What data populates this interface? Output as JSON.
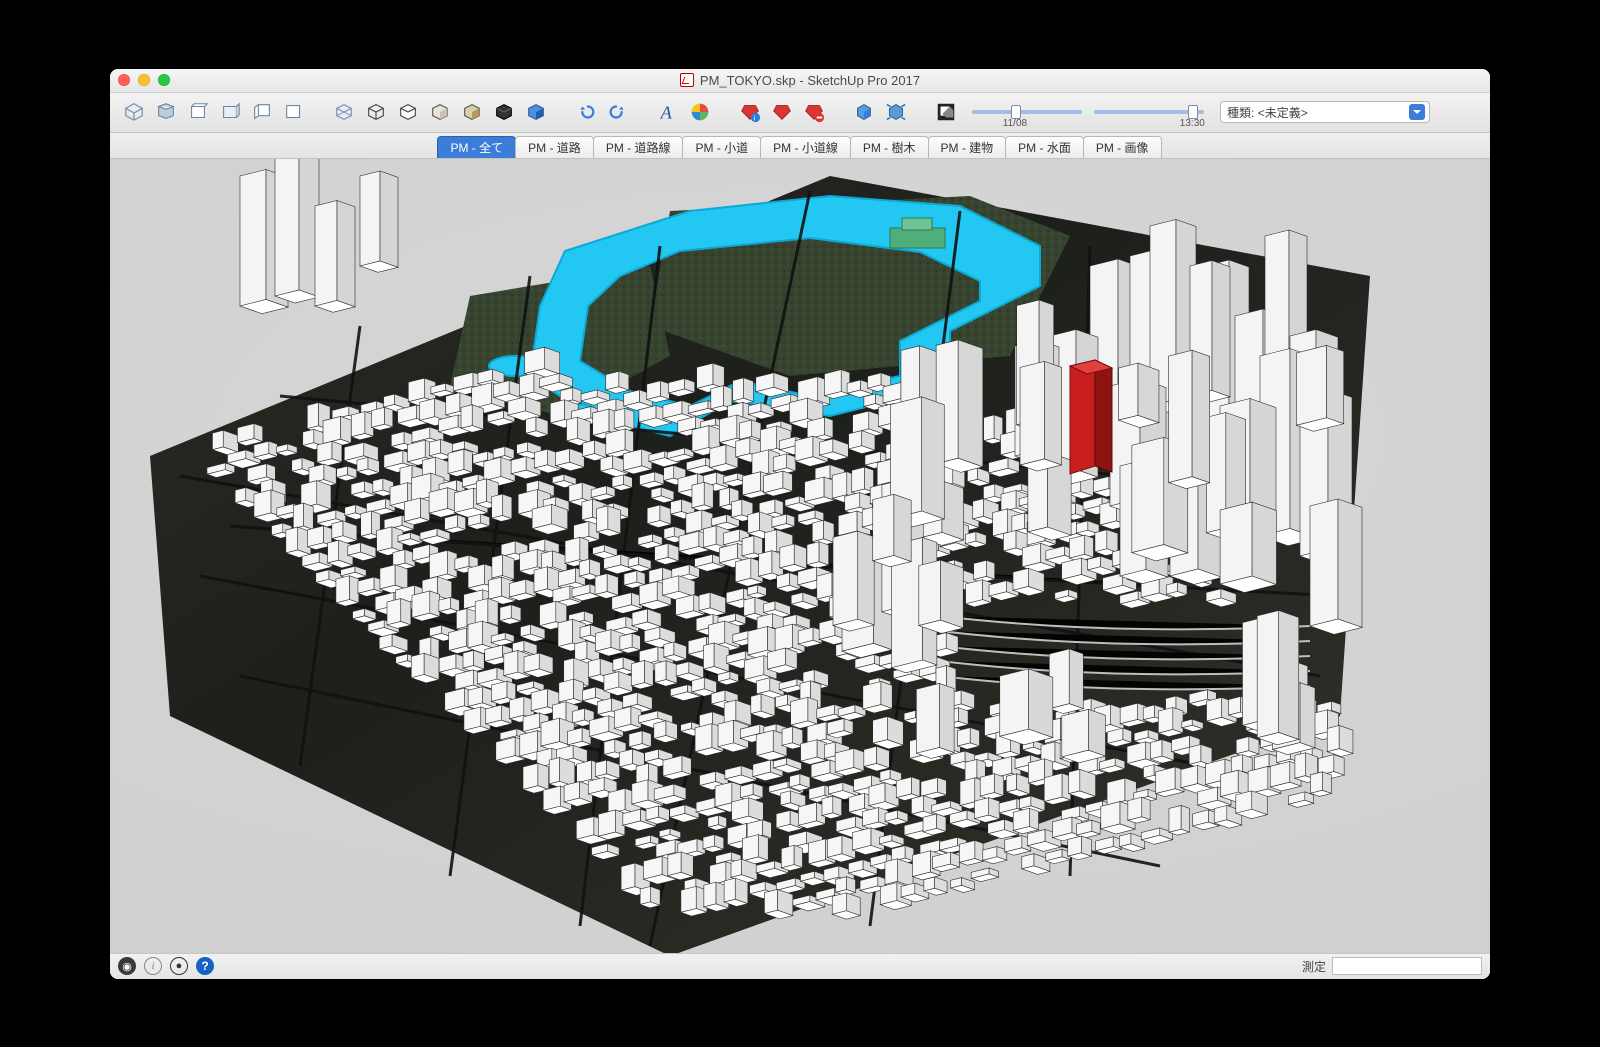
{
  "window": {
    "title": "PM_TOKYO.skp - SketchUp Pro 2017"
  },
  "toolbar": {
    "icons": [
      "iso-view",
      "top-view",
      "front-view",
      "back-view",
      "left-view",
      "right-view",
      "style1",
      "style2",
      "style3",
      "style4",
      "style5",
      "style6",
      "style7",
      "undo",
      "redo",
      "text-A",
      "color-wheel",
      "ruby-info",
      "ruby-add",
      "ruby-ext",
      "cube-wire",
      "cube-explode",
      "shadow-toggle"
    ],
    "date_slider": {
      "value_pos": 35,
      "label": "11/08"
    },
    "time_slider": {
      "value_pos": 85,
      "label": "13:30"
    },
    "type_label": "種類:",
    "type_value": "<未定義>"
  },
  "scene_tabs": [
    {
      "label": "PM - 全て",
      "active": true
    },
    {
      "label": "PM - 道路",
      "active": false
    },
    {
      "label": "PM - 道路線",
      "active": false
    },
    {
      "label": "PM - 小道",
      "active": false
    },
    {
      "label": "PM - 小道線",
      "active": false
    },
    {
      "label": "PM - 樹木",
      "active": false
    },
    {
      "label": "PM - 建物",
      "active": false
    },
    {
      "label": "PM - 水面",
      "active": false
    },
    {
      "label": "PM - 画像",
      "active": false
    }
  ],
  "statusbar": {
    "measure_label": "測定",
    "measure_value": ""
  },
  "colors": {
    "water": "#22c7f2",
    "building": "#f2f2f2",
    "building_edge": "#2b2b2b",
    "ground_dark": "#1e1f1d",
    "ground_green": "#3e4a32",
    "road": "#2a2a2a",
    "accent_red": "#c81e1e"
  }
}
